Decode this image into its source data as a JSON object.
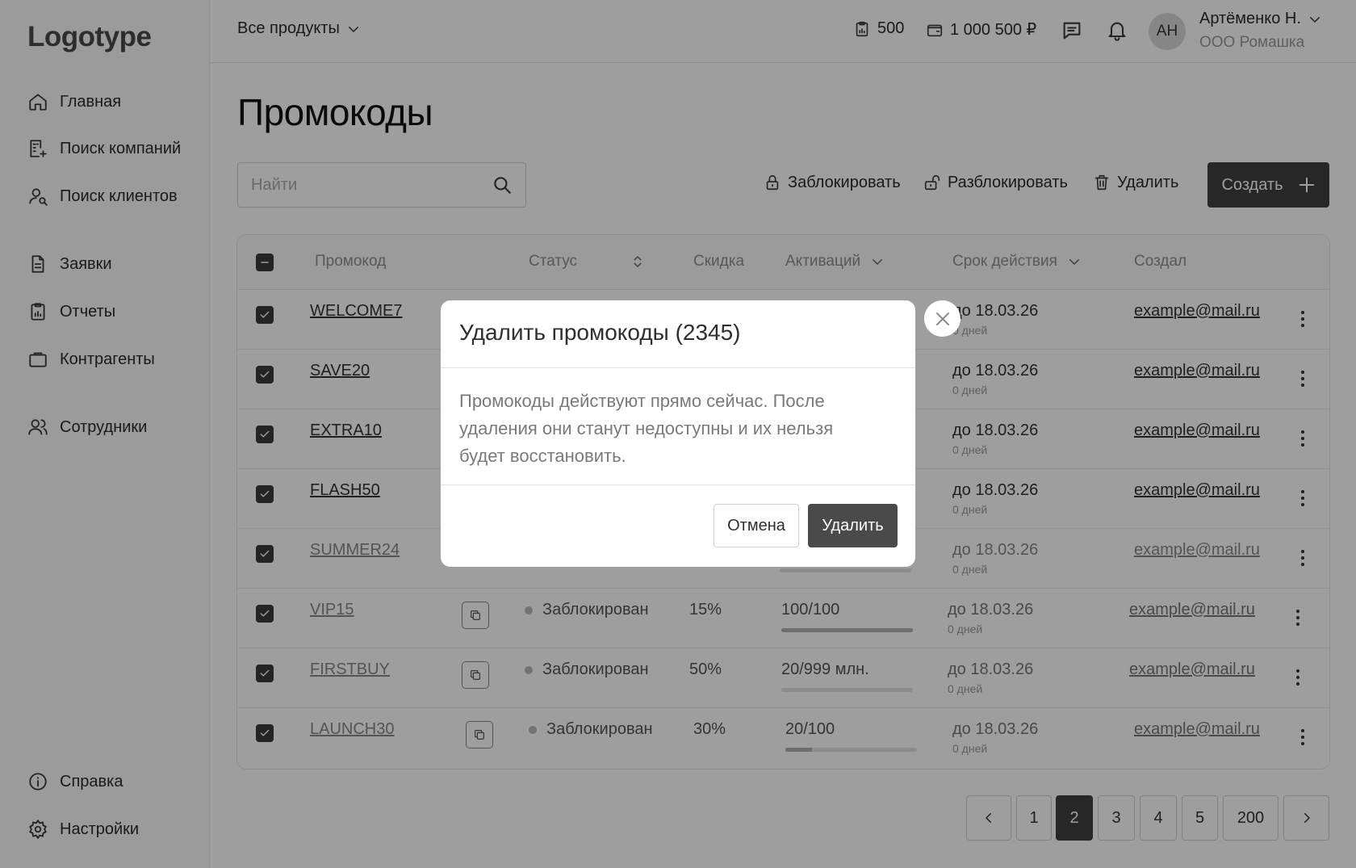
{
  "sidebar": {
    "logo": "Logotype",
    "items": [
      {
        "label": "Главная",
        "icon": "home-icon"
      },
      {
        "label": "Поиск компаний",
        "icon": "building-search-icon"
      },
      {
        "label": "Поиск клиентов",
        "icon": "user-search-icon"
      },
      {
        "label": "Заявки",
        "icon": "document-icon"
      },
      {
        "label": "Отчеты",
        "icon": "clipboard-icon"
      },
      {
        "label": "Контрагенты",
        "icon": "briefcase-icon"
      },
      {
        "label": "Сотрудники",
        "icon": "users-icon"
      }
    ],
    "bottom": [
      {
        "label": "Справка",
        "icon": "info-icon"
      },
      {
        "label": "Настройки",
        "icon": "gear-icon"
      }
    ]
  },
  "topbar": {
    "product_select": "Все продукты",
    "stat_count": "500",
    "stat_balance": "1 000 500 ₽",
    "user": {
      "initials": "АН",
      "name": "Артёменко Н.",
      "company": "ООО Ромашка"
    }
  },
  "page": {
    "title": "Промокоды",
    "search_placeholder": "Найти",
    "actions": {
      "block": "Заблокировать",
      "unblock": "Разблокировать",
      "delete": "Удалить",
      "create": "Создать"
    }
  },
  "table": {
    "columns": {
      "code": "Промокод",
      "status": "Статус",
      "discount": "Скидка",
      "activations": "Активаций",
      "validity": "Срок действия",
      "creator": "Создал"
    },
    "rows": [
      {
        "code": "WELCOME7",
        "status": "",
        "discount": "",
        "activations": "",
        "activation_fill": 0,
        "until": "до 18.03.26",
        "days": "0 дней",
        "creator": "example@mail.ru"
      },
      {
        "code": "SAVE20",
        "status": "",
        "discount": "",
        "activations": "",
        "activation_fill": 0,
        "until": "до 18.03.26",
        "days": "0 дней",
        "creator": "example@mail.ru"
      },
      {
        "code": "EXTRA10",
        "status": "",
        "discount": "",
        "activations": "",
        "activation_fill": 0,
        "until": "до 18.03.26",
        "days": "0 дней",
        "creator": "example@mail.ru"
      },
      {
        "code": "FLASH50",
        "status": "",
        "discount": "",
        "activations": "",
        "activation_fill": 0,
        "until": "до 18.03.26",
        "days": "0 дней",
        "creator": "example@mail.ru"
      },
      {
        "code": "SUMMER24",
        "status": "",
        "discount": "",
        "activations": "",
        "activation_fill": 0,
        "until": "до 18.03.26",
        "days": "0 дней",
        "creator": "example@mail.ru"
      },
      {
        "code": "VIP15",
        "status": "Заблокирован",
        "discount": "15%",
        "activations": "100/100",
        "activation_fill": 1.0,
        "until": "до 18.03.26",
        "days": "0 дней",
        "creator": "example@mail.ru"
      },
      {
        "code": "FIRSTBUY",
        "status": "Заблокирован",
        "discount": "50%",
        "activations": "20/999 млн.",
        "activation_fill": 0.0,
        "until": "до 18.03.26",
        "days": "0 дней",
        "creator": "example@mail.ru"
      },
      {
        "code": "LAUNCH30",
        "status": "Заблокирован",
        "discount": "30%",
        "activations": "20/100",
        "activation_fill": 0.2,
        "until": "до 18.03.26",
        "days": "0 дней",
        "creator": "example@mail.ru"
      }
    ]
  },
  "pagination": {
    "pages": [
      "1",
      "2",
      "3",
      "4",
      "5",
      "200"
    ],
    "current": "2"
  },
  "modal": {
    "title": "Удалить промокоды (2345)",
    "text": "Промокоды действуют прямо сейчас. После удаления они станут недоступны и их нельзя будет восстановить.",
    "cancel": "Отмена",
    "confirm": "Удалить"
  }
}
